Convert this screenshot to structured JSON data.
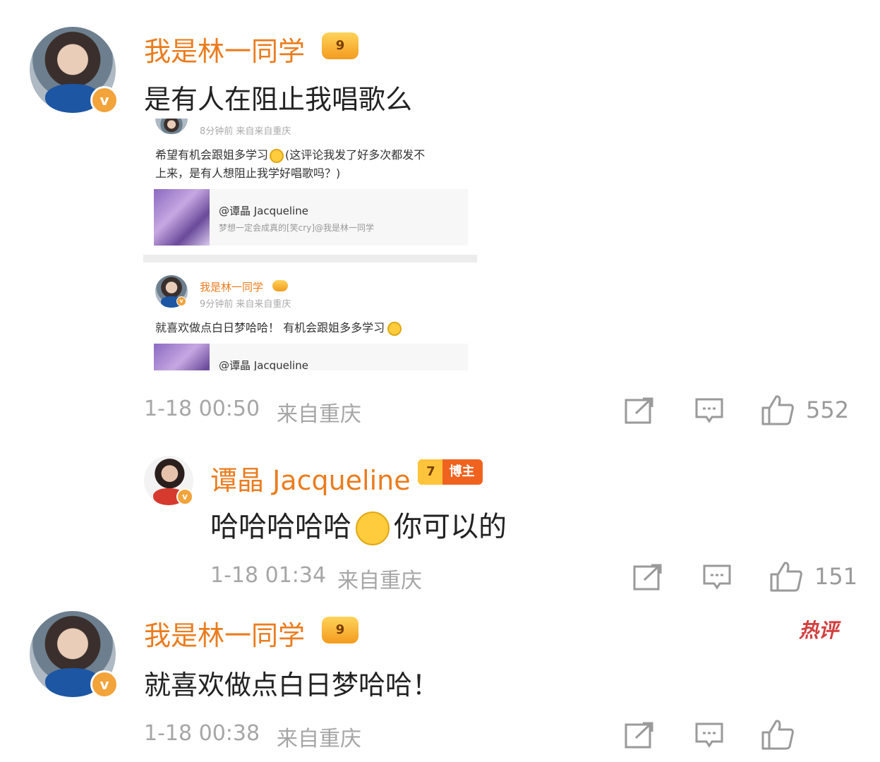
{
  "comments": [
    {
      "author": "我是林一同学",
      "crown_level": "9",
      "text": "是有人在阻止我唱歌么",
      "time": "1-18 00:50",
      "source": "来自重庆",
      "likes": "552"
    },
    {
      "author": "谭晶 Jacqueline",
      "crown_level": "7",
      "crown_tag": "博主",
      "text_before": "哈哈哈哈哈",
      "text_after": "你可以的",
      "time": "1-18 01:34",
      "source": "来自重庆",
      "likes": "151"
    },
    {
      "author": "我是林一同学",
      "crown_level": "9",
      "text": "就喜欢做点白日梦哈哈！",
      "time": "1-18 00:38",
      "source": "来自重庆",
      "hot_label": "热评"
    }
  ],
  "screenshot": {
    "post1": {
      "meta": "8分钟前   来自来自重庆",
      "line1": "希望有机会跟姐多学习",
      "line1_tail": "(这评论我发了好多次都发不",
      "line2": "上来，是有人想阻止我学好唱歌吗？)",
      "card_title": "@谭晶 Jacqueline",
      "card_sub": "梦想一定会成真的[笑cry]@我是林一同学"
    },
    "post2": {
      "author": "我是林一同学",
      "meta": "9分钟前   来自来自重庆",
      "text": "就喜欢做点白日梦哈哈！  有机会跟姐多多学习",
      "card_title": "@谭晶 Jacqueline"
    }
  },
  "colors": {
    "name": "#eb7c1e",
    "meta": "#a6a6a6",
    "badge": "#f2a33a",
    "hot": "#d23e3e"
  },
  "icons": [
    "verified-badge-icon",
    "crown-icon",
    "share-icon",
    "comment-icon",
    "like-icon"
  ]
}
